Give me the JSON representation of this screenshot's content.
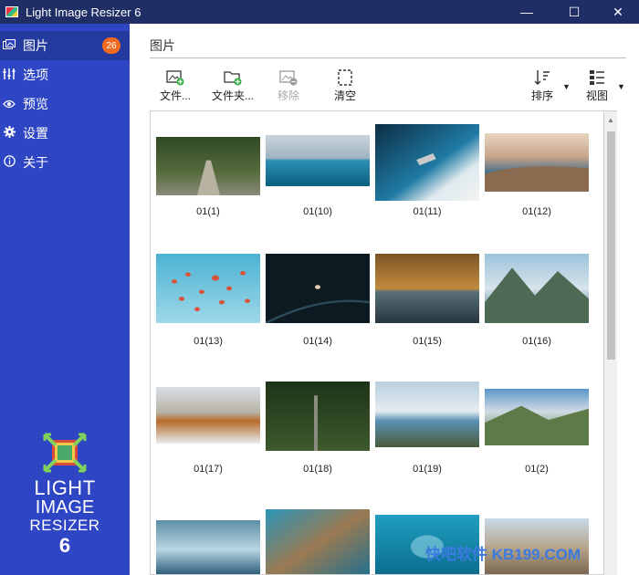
{
  "window": {
    "title": "Light Image Resizer 6",
    "minimize": "—",
    "maximize": "☐",
    "close": "✕"
  },
  "sidebar": {
    "items": [
      {
        "label": "图片",
        "icon": "images-icon",
        "badge": "26"
      },
      {
        "label": "选项",
        "icon": "sliders-icon"
      },
      {
        "label": "预览",
        "icon": "eye-icon"
      },
      {
        "label": "设置",
        "icon": "gear-icon"
      },
      {
        "label": "关于",
        "icon": "info-icon"
      }
    ],
    "logo": {
      "line1": "LIGHT",
      "line2": "IMAGE",
      "line3": "RESIZER",
      "line4": "6"
    }
  },
  "main": {
    "title": "图片",
    "toolbar": {
      "add_files": "文件...",
      "add_folder": "文件夹...",
      "remove": "移除",
      "clear": "清空",
      "sort": "排序",
      "view": "视图"
    },
    "thumbnails": [
      {
        "caption": "01(1)",
        "scene": "tree-lined road"
      },
      {
        "caption": "01(10)",
        "scene": "calm sea horizon"
      },
      {
        "caption": "01(11)",
        "scene": "aerial boat on turquoise water"
      },
      {
        "caption": "01(12)",
        "scene": "coastline at sunset"
      },
      {
        "caption": "01(13)",
        "scene": "hot air balloons"
      },
      {
        "caption": "01(14)",
        "scene": "person in dark water"
      },
      {
        "caption": "01(15)",
        "scene": "autumn lake"
      },
      {
        "caption": "01(16)",
        "scene": "mountain fjord"
      },
      {
        "caption": "01(17)",
        "scene": "autumn mountains"
      },
      {
        "caption": "01(18)",
        "scene": "forest"
      },
      {
        "caption": "01(19)",
        "scene": "mountain lake"
      },
      {
        "caption": "01(2)",
        "scene": "green mountains"
      },
      {
        "caption": "",
        "scene": "ocean wave"
      },
      {
        "caption": "",
        "scene": "aerial coast"
      },
      {
        "caption": "",
        "scene": "underwater"
      },
      {
        "caption": "",
        "scene": "city view"
      }
    ]
  },
  "watermark": "快吧软件 KB199.COM",
  "colors": {
    "titlebar": "#1f2f66",
    "sidebar": "#2f46c4",
    "badge": "#f26a21"
  }
}
